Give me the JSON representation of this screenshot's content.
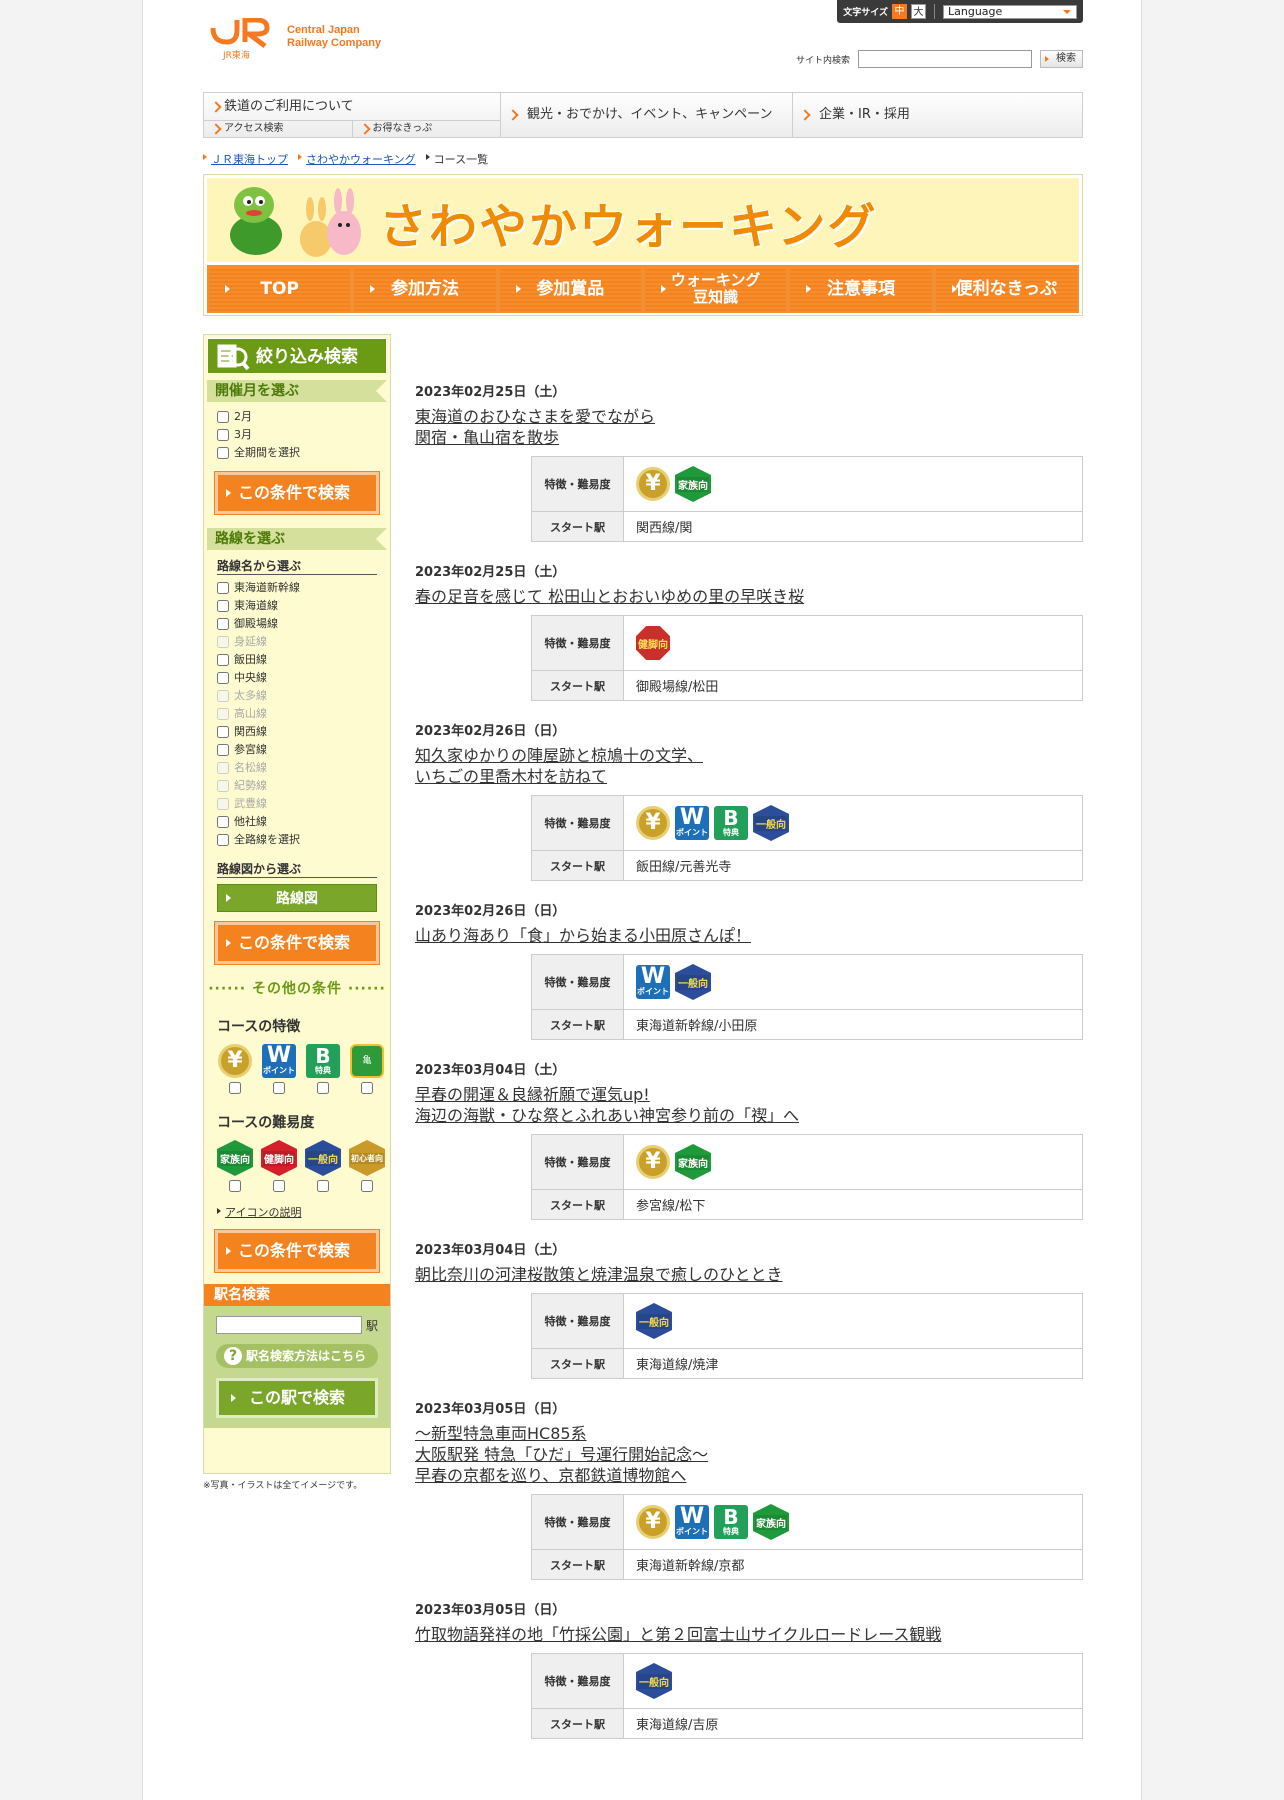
{
  "header": {
    "logo_text": "JR東海",
    "company_line1": "Central Japan",
    "company_line2": "Railway Company",
    "text_size_label": "文字サイズ",
    "size_mid": "中",
    "size_large": "大",
    "language": "Language",
    "site_search_label": "サイト内検索",
    "search_button": "検索"
  },
  "gnav": {
    "railway": "鉄道のご利用について",
    "access": "アクセス検索",
    "tickets": "お得なきっぷ",
    "tourism": "観光・おでかけ、イベント、キャンペーン",
    "corporate": "企業・IR・採用"
  },
  "breadcrumb": {
    "home": "ＪＲ東海トップ",
    "walking": "さわやかウォーキング",
    "current": "コース一覧"
  },
  "banner": {
    "title": "さわやかウォーキング",
    "nav": [
      "TOP",
      "参加方法",
      "参加賞品",
      "ウォーキング豆知識",
      "注意事項",
      "便利なきっぷ"
    ]
  },
  "sidebar": {
    "header": "絞り込み検索",
    "month_section": "開催月を選ぶ",
    "months": [
      "2月",
      "3月",
      "全期間を選択"
    ],
    "search_btn": "この条件で検索",
    "line_section": "路線を選ぶ",
    "by_name": "路線名から選ぶ",
    "lines": [
      {
        "name": "東海道新幹線",
        "en": true
      },
      {
        "name": "東海道線",
        "en": true
      },
      {
        "name": "御殿場線",
        "en": true
      },
      {
        "name": "身延線",
        "en": false
      },
      {
        "name": "飯田線",
        "en": true
      },
      {
        "name": "中央線",
        "en": true
      },
      {
        "name": "太多線",
        "en": false
      },
      {
        "name": "高山線",
        "en": false
      },
      {
        "name": "関西線",
        "en": true
      },
      {
        "name": "参宮線",
        "en": true
      },
      {
        "name": "名松線",
        "en": false
      },
      {
        "name": "紀勢線",
        "en": false
      },
      {
        "name": "武豊線",
        "en": false
      },
      {
        "name": "他社線",
        "en": true
      },
      {
        "name": "全路線を選択",
        "en": true
      }
    ],
    "by_map": "路線図から選ぶ",
    "map_btn": "路線図",
    "other": "その他の条件",
    "feature_title": "コースの特徴",
    "difficulty_title": "コースの難易度",
    "icon_explain": "アイコンの説明",
    "station_title": "駅名検索",
    "station_suffix": "駅",
    "station_help": "駅名検索方法はこちら",
    "station_btn": "この駅で検索",
    "note": "※写真・イラストは全てイメージです。"
  },
  "icons": {
    "yen": "¥",
    "w": "W",
    "w_sub": "ポイント",
    "b": "B",
    "b_sub": "特典",
    "family": "家族向",
    "health": "健脚向",
    "general": "一般向",
    "beginner": "初心者向",
    "kame": "亀"
  },
  "table_labels": {
    "feature": "特徴・難易度",
    "start": "スタート駅"
  },
  "courses": [
    {
      "date": "2023年02月25日（土）",
      "title": [
        "東海道のおひなさまを愛でながら",
        "関宿・亀山宿を散歩"
      ],
      "station": "関西線/関"
    },
    {
      "date": "2023年02月25日（土）",
      "title": [
        "春の足音を感じて 松田山とおおいゆめの里の早咲き桜"
      ],
      "station": "御殿場線/松田"
    },
    {
      "date": "2023年02月26日（日）",
      "title": [
        "知久家ゆかりの陣屋跡と椋鳩十の文学、",
        "いちごの里喬木村を訪ねて"
      ],
      "station": "飯田線/元善光寺"
    },
    {
      "date": "2023年02月26日（日）",
      "title": [
        "山あり海あり「食」から始まる小田原さんぽ！"
      ],
      "station": "東海道新幹線/小田原"
    },
    {
      "date": "2023年03月04日（土）",
      "title": [
        "早春の開運＆良縁祈願で運気up!",
        "海辺の海獣・ひな祭とふれあい神宮参り前の「禊」へ"
      ],
      "station": "参宮線/松下"
    },
    {
      "date": "2023年03月04日（土）",
      "title": [
        "朝比奈川の河津桜散策と焼津温泉で癒しのひととき"
      ],
      "station": "東海道線/焼津"
    },
    {
      "date": "2023年03月05日（日）",
      "title": [
        "～新型特急車両HC85系",
        "大阪駅発 特急「ひだ」号運行開始記念～",
        "早春の京都を巡り、京都鉄道博物館へ"
      ],
      "station": "東海道新幹線/京都"
    },
    {
      "date": "2023年03月05日（日）",
      "title": [
        "竹取物語発祥の地「竹採公園」と第２回富士山サイクルロードレース観戦"
      ],
      "station": "東海道線/吉原"
    }
  ],
  "colors": {
    "orange": "#f47920",
    "green": "#6b9a15"
  }
}
